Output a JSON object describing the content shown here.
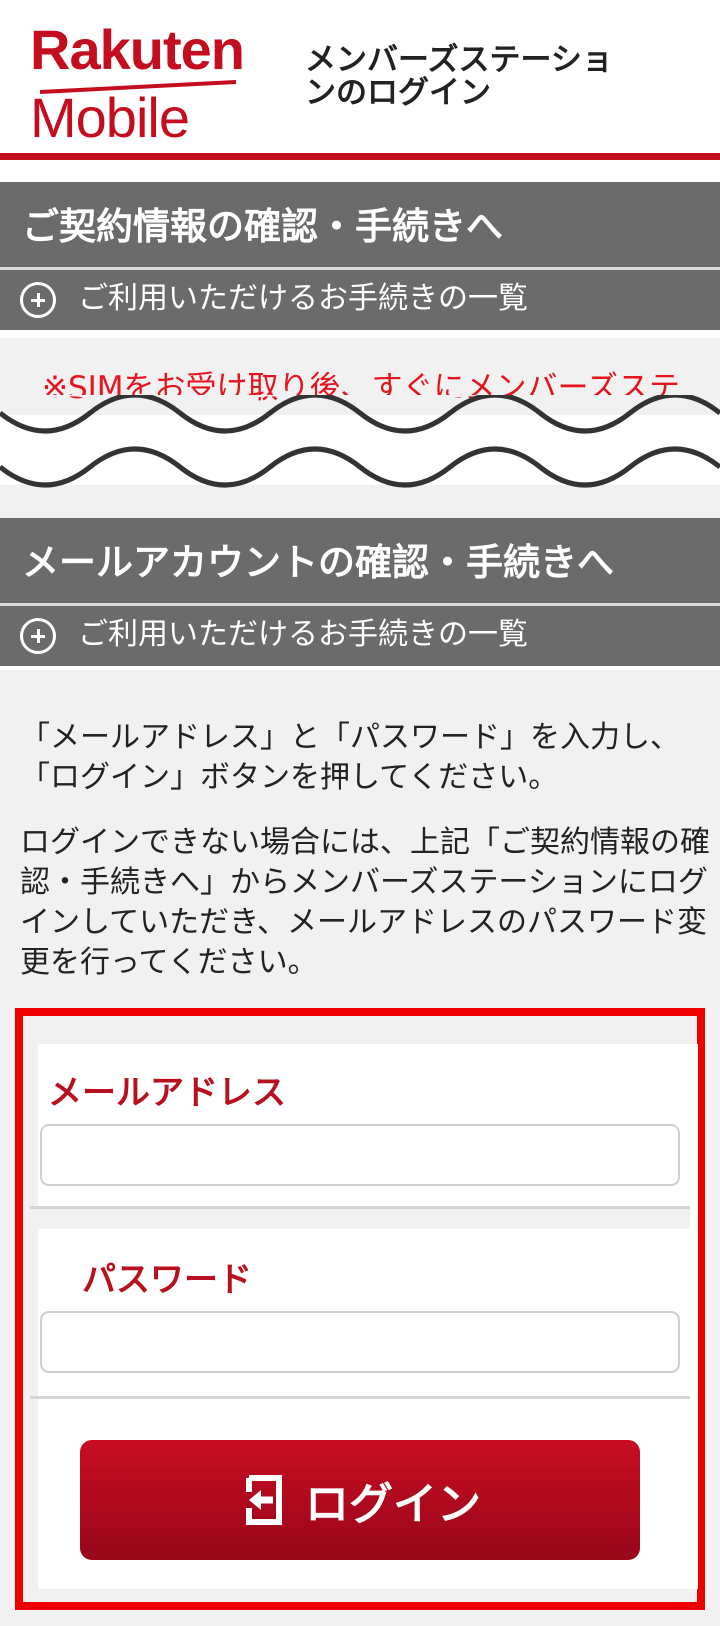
{
  "header": {
    "logo_line1": "Rakuten",
    "logo_line2": "Mobile",
    "title": "メンバーズステーションのログイン"
  },
  "section1": {
    "title": "ご契約情報の確認・手続きへ",
    "sub_label": "ご利用いただけるお手続きの一覧"
  },
  "notice": {
    "text": "※SIMをお受け取り後、すぐにメンバーズステ"
  },
  "section2": {
    "title": "メールアカウントの確認・手続きへ",
    "sub_label": "ご利用いただけるお手続きの一覧"
  },
  "description": {
    "para1": "「メールアドレス」と「パスワード」を入力し、「ログイン」ボタンを押してください。",
    "para2": "ログインできない場合には、上記「ご契約情報の確認・手続きへ」からメンバーズステーションにログインしていただき、メールアドレスのパスワード変更を行ってください。"
  },
  "form": {
    "email_label": "メールアドレス",
    "email_value": "",
    "password_label": "パスワード",
    "password_value": "",
    "login_label": "ログイン"
  },
  "colors": {
    "brand_red": "#c40d1e",
    "section_gray": "#6b6b6b",
    "highlight_frame": "#ee0000"
  }
}
